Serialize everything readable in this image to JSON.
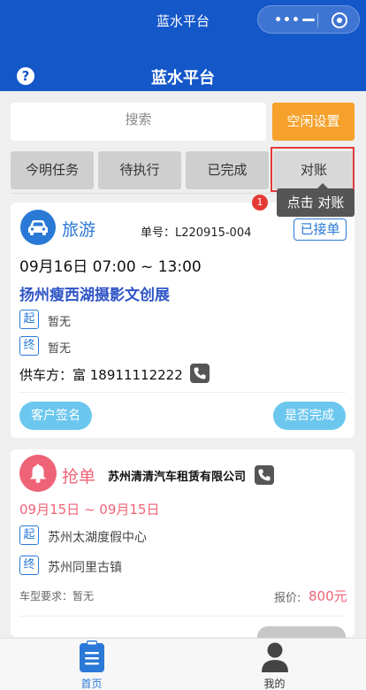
{
  "miniprogram": {
    "title": "蓝水平台",
    "capsule_more": "•••"
  },
  "header": {
    "title": "蓝水平台",
    "help": "?"
  },
  "search": {
    "placeholder": "搜索"
  },
  "idle_button": "空闲设置",
  "tabs": [
    {
      "label": "今明任务"
    },
    {
      "label": "待执行"
    },
    {
      "label": "已完成"
    },
    {
      "label": "对账"
    }
  ],
  "tooltip": {
    "badge": "1",
    "text": "点击 对账"
  },
  "card1": {
    "type": "旅游",
    "order_no": "单号：L220915-004",
    "status": "已接单",
    "time": "09月16日 07:00 ~ 13:00",
    "event": "扬州瘦西湖摄影文创展",
    "start_tag": "起",
    "start": "暂无",
    "end_tag": "终",
    "end": "暂无",
    "supplier": "供车方：富  18911112222",
    "btn_left": "客户签名",
    "btn_right": "是否完成"
  },
  "card2": {
    "type": "抢单",
    "company": "苏州清清汽车租赁有限公司",
    "date_range": "09月15日 ~ 09月15日",
    "start_tag": "起",
    "start": "苏州太湖度假中心",
    "end_tag": "终",
    "end": "苏州同里古镇",
    "requirement": "车型要求：暂无",
    "price_label": "报价:",
    "price": "800元"
  },
  "tabbar": {
    "home": "首页",
    "me": "我的"
  },
  "colors": {
    "brand": "#1457c9",
    "accent_blue": "#2a79d6",
    "orange": "#f5a12b",
    "pink": "#ef6377",
    "highlight": "#e23b3b"
  }
}
